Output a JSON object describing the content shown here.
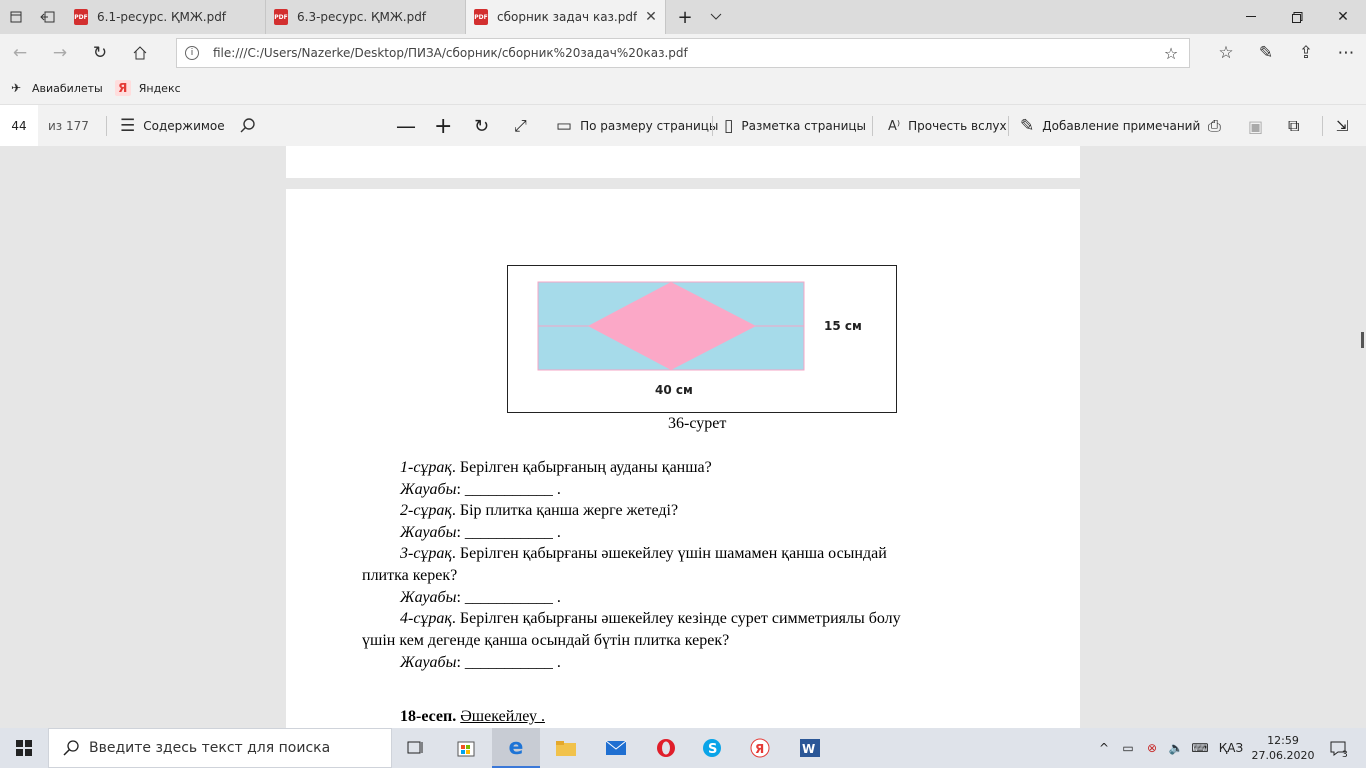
{
  "tabs": [
    {
      "label": "6.1-ресурс. ҚМЖ.pdf",
      "icon": "pdf-icon"
    },
    {
      "label": "6.3-ресурс. ҚМЖ.pdf",
      "icon": "pdf-icon"
    },
    {
      "label": "сборник задач каз.pdf",
      "icon": "pdf-icon",
      "active": true
    }
  ],
  "address": {
    "url": "file:///C:/Users/Nazerke/Desktop/ПИЗА/сборник/сборник%20задач%20каз.pdf"
  },
  "favorites": [
    {
      "label": "Авиабилеты",
      "icon": "plane-icon"
    },
    {
      "label": "Яндекс",
      "icon": "yandex-icon"
    }
  ],
  "pdf_toolbar": {
    "page_number": "44",
    "page_total": "из 177",
    "contents": "Содержимое",
    "fit_page": "По размеру страницы",
    "layout": "Разметка страницы",
    "read_aloud": "Прочесть вслух",
    "annotations": "Добавление примечаний"
  },
  "document": {
    "figure": {
      "height_label": "15 см",
      "width_label": "40 см",
      "caption": "36-сурет",
      "colors": {
        "background": "#a6dbea",
        "diamond": "#fba8c7"
      }
    },
    "q1_label": "1-сұрақ",
    "q1_text": ". Берілген қабырғаның ауданы қанша?",
    "answer_label": "Жауабы",
    "answer_blank": ": ___________ .",
    "q2_label": "2-сұрақ",
    "q2_text": ". Бір плитка қанша жерге жетеді?",
    "q3_label": "3-сұрақ",
    "q3_text": ". Берілген қабырғаны әшекейлеу үшін шамамен қанша осындай",
    "q3_text_cont": "плитка керек?",
    "q4_label": "4-сұрақ",
    "q4_text": ". Берілген қабырғаны әшекейлеу кезінде сурет симметриялы болу",
    "q4_text_cont": "үшін кем дегенде қанша осындай бүтін плитка керек?",
    "task_number": "18-есеп.",
    "task_title": "Әшекейлеу ."
  },
  "taskbar": {
    "search_placeholder": "Введите здесь текст для поиска",
    "language": "ҚАЗ",
    "time": "12:59",
    "date": "27.06.2020",
    "notification_count": "3"
  }
}
